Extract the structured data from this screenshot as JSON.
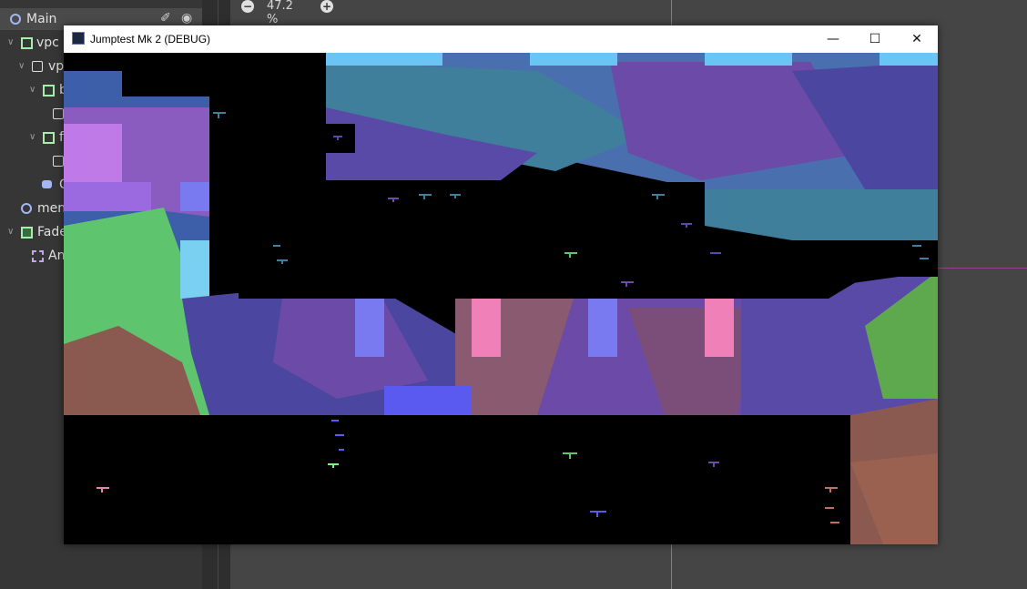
{
  "editor": {
    "zoom_level": "47.2 %",
    "zoom_out_icon": "minus-circle-icon",
    "zoom_in_icon": "plus-circle-icon",
    "scene_tree": {
      "nodes": [
        {
          "label": "Main",
          "icon": "node-circle-icon",
          "icon_color": "#a5b7f3"
        },
        {
          "label": "vpc",
          "icon": "viewport-container-icon",
          "icon_color": "#a5efac"
        },
        {
          "label": "vp",
          "icon": "viewport-icon",
          "icon_color": "#e0e0e0"
        },
        {
          "label": "b",
          "icon": "container-icon",
          "icon_color": "#a5efac"
        },
        {
          "label": "",
          "icon": "viewport-icon",
          "icon_color": "#e0e0e0"
        },
        {
          "label": "f",
          "icon": "container-icon",
          "icon_color": "#a5efac"
        },
        {
          "label": "",
          "icon": "viewport-icon",
          "icon_color": "#e0e0e0"
        },
        {
          "label": "C",
          "icon": "camera-icon",
          "icon_color": "#a5b7f3"
        },
        {
          "label": "men",
          "icon": "node-circle-icon",
          "icon_color": "#a5b7f3"
        },
        {
          "label": "Fade",
          "icon": "color-rect-icon",
          "icon_color": "#a5efac"
        },
        {
          "label": "An",
          "icon": "animation-player-icon",
          "icon_color": "#c8a5f3"
        }
      ],
      "script_icon": "script-icon",
      "visibility_icon": "eye-icon"
    }
  },
  "window": {
    "title": "Jumptest Mk 2 (DEBUG)",
    "app_icon": "godot-app-icon",
    "minimize_label": "—",
    "maximize_label": "☐",
    "close_label": "✕"
  },
  "colors": {
    "sky_blue": "#6ac4f4",
    "teal": "#3f7f9c",
    "blue": "#3d5ea8",
    "purple": "#6b4aa8",
    "violet": "#8a5cc0",
    "pink": "#f080b8",
    "green": "#5ed06a",
    "brown": "#8a5a50",
    "black": "#000000"
  }
}
